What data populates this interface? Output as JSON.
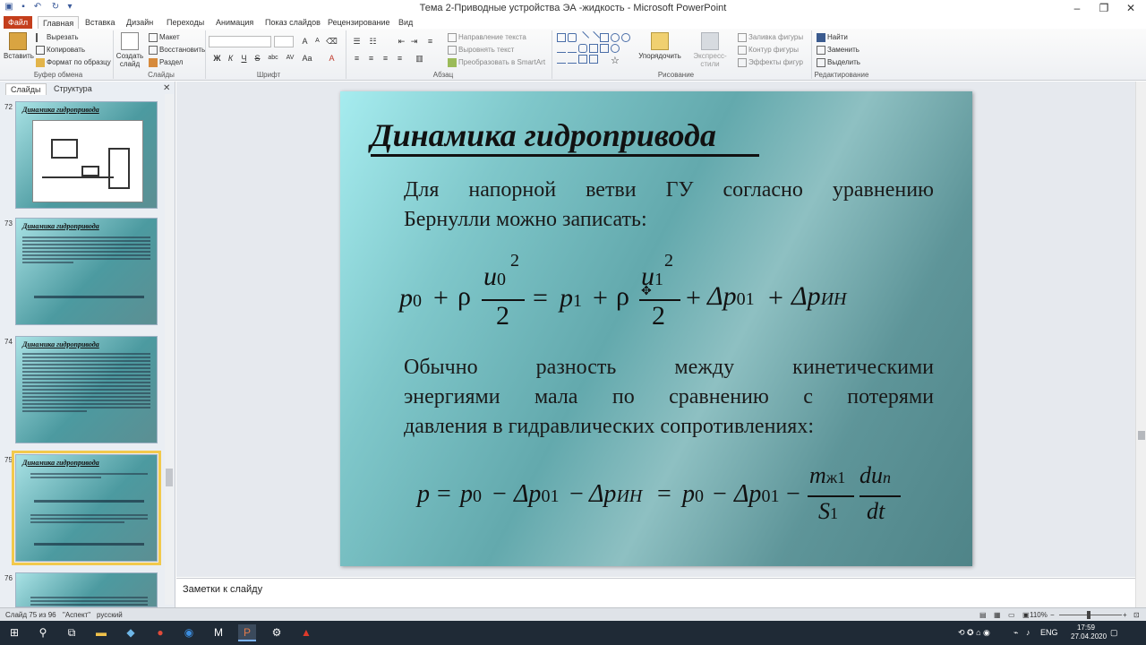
{
  "window": {
    "title": "Тема 2-Приводные устройства ЭА -жидкость - Microsoft PowerPoint"
  },
  "ribbon": {
    "tabs": [
      "Файл",
      "Главная",
      "Вставка",
      "Дизайн",
      "Переходы",
      "Анимация",
      "Показ слайдов",
      "Рецензирование",
      "Вид"
    ],
    "clipboard": {
      "paste": "Вставить",
      "cut": "Вырезать",
      "copy": "Копировать",
      "format_painter": "Формат по образцу",
      "group": "Буфер обмена"
    },
    "slides": {
      "new_slide": "Создать слайд",
      "layout": "Макет",
      "reset": "Восстановить",
      "section": "Раздел",
      "group": "Слайды"
    },
    "font": {
      "group": "Шрифт",
      "size_up": "A",
      "size_down": "A",
      "bold": "Ж",
      "italic": "К",
      "underline": "Ч",
      "strike": "S",
      "shadow": "abc",
      "spacing": "AV",
      "case": "Aa",
      "color": "A"
    },
    "paragraph": {
      "group": "Абзац",
      "text_direction": "Направление текста",
      "align_text": "Выровнять текст",
      "smartart": "Преобразовать в SmartArt"
    },
    "drawing": {
      "group": "Рисование",
      "arrange": "Упорядочить",
      "quick_styles": "Экспресс-стили",
      "fill": "Заливка фигуры",
      "outline": "Контур фигуры",
      "effects": "Эффекты фигур"
    },
    "editing": {
      "group": "Редактирование",
      "find": "Найти",
      "replace": "Заменить",
      "select": "Выделить"
    }
  },
  "left_panel": {
    "tabs": [
      "Слайды",
      "Структура"
    ],
    "thumbnails": [
      {
        "number": "72",
        "title": "Динамика гидропривода"
      },
      {
        "number": "73",
        "title": "Динамика гидропривода"
      },
      {
        "number": "74",
        "title": "Динамика гидропривода"
      },
      {
        "number": "75",
        "title": "Динамика гидропривода"
      },
      {
        "number": "76",
        "title": ""
      }
    ]
  },
  "slide": {
    "title": "Динамика гидропривода",
    "para1": "Для напорной ветви ГУ согласно уравнению",
    "para1b": "Бернулли можно записать:",
    "para2a": "Обычно разность между кинетическими",
    "para2b": "энергиями мала по сравнению с потерями",
    "para2c": "давления в гидравлических сопротивлениях:",
    "eq1": {
      "p": "p",
      "s0": "0",
      "plus": "+",
      "rho": "ρ",
      "u": "u",
      "exp": "2",
      "den": "2",
      "eq": "=",
      "s1": "1",
      "dp": "Δp",
      "s01": "01",
      "sin": "ИН"
    },
    "eq2": {
      "p": "p",
      "eq": "=",
      "minus": "−",
      "dp": "Δp",
      "s0": "0",
      "s01": "01",
      "sin": "ИН",
      "m": "m",
      "sm": "ж1",
      "S": "S",
      "s1": "1",
      "du": "du",
      "sn": "n",
      "dt": "dt"
    }
  },
  "notes": {
    "placeholder": "Заметки к слайду"
  },
  "statusbar": {
    "slide_info": "Слайд 75 из 96",
    "theme": "\"Аспект\"",
    "language": "русский",
    "zoom": "110%"
  },
  "taskbar": {
    "language": "ENG",
    "time": "17:59",
    "date": "27.04.2020"
  }
}
